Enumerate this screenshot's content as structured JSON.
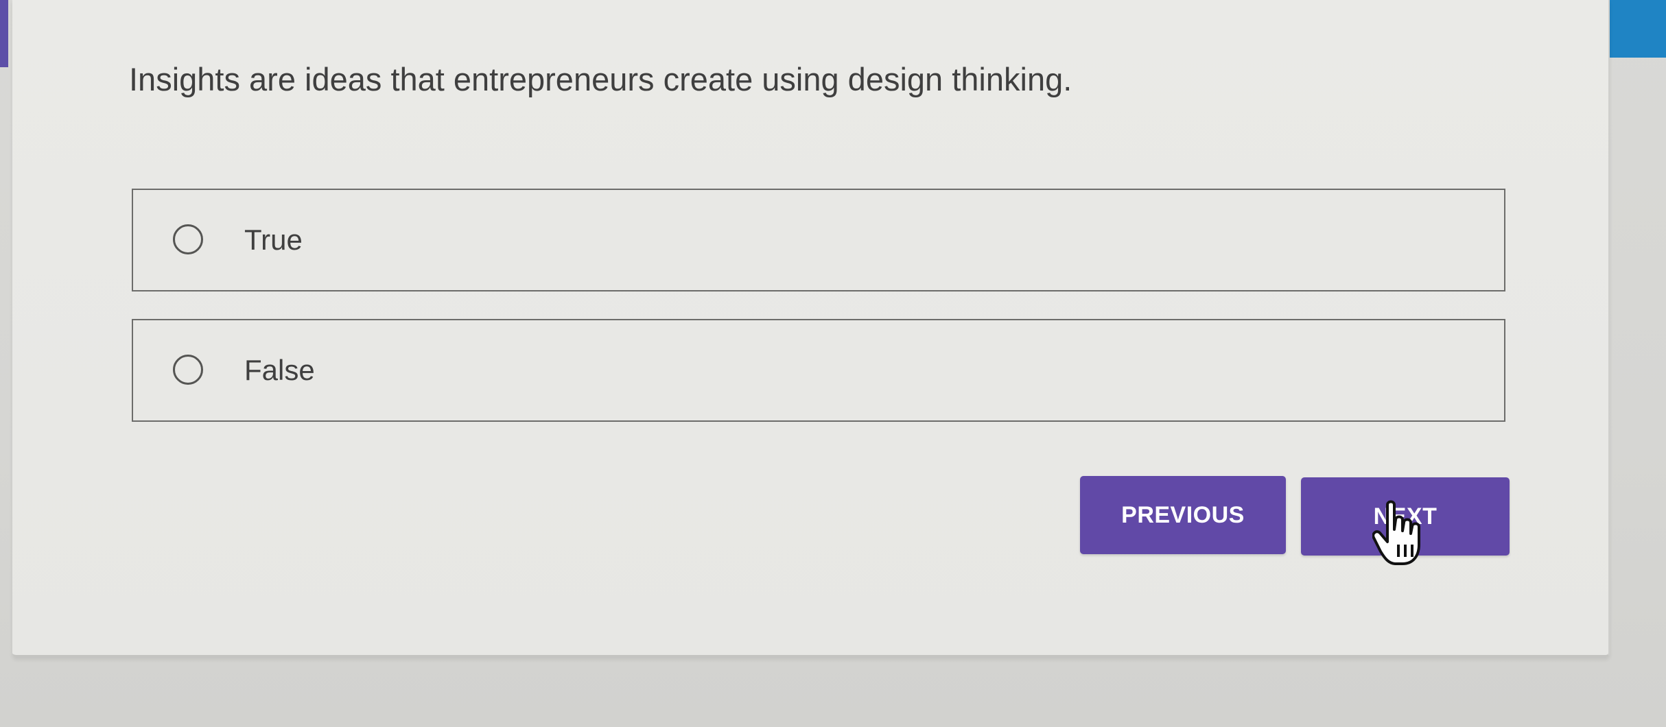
{
  "question": {
    "text": "Insights are ideas that entrepreneurs create using design thinking."
  },
  "options": [
    {
      "label": "True",
      "selected": false
    },
    {
      "label": "False",
      "selected": false
    }
  ],
  "navigation": {
    "previous_label": "PREVIOUS",
    "next_label": "NEXT"
  },
  "colors": {
    "button": "#6149a7",
    "left_accent": "#5d4fa8",
    "right_accent": "#1f84c4"
  },
  "cursor": {
    "icon": "hand-pointer-icon"
  }
}
